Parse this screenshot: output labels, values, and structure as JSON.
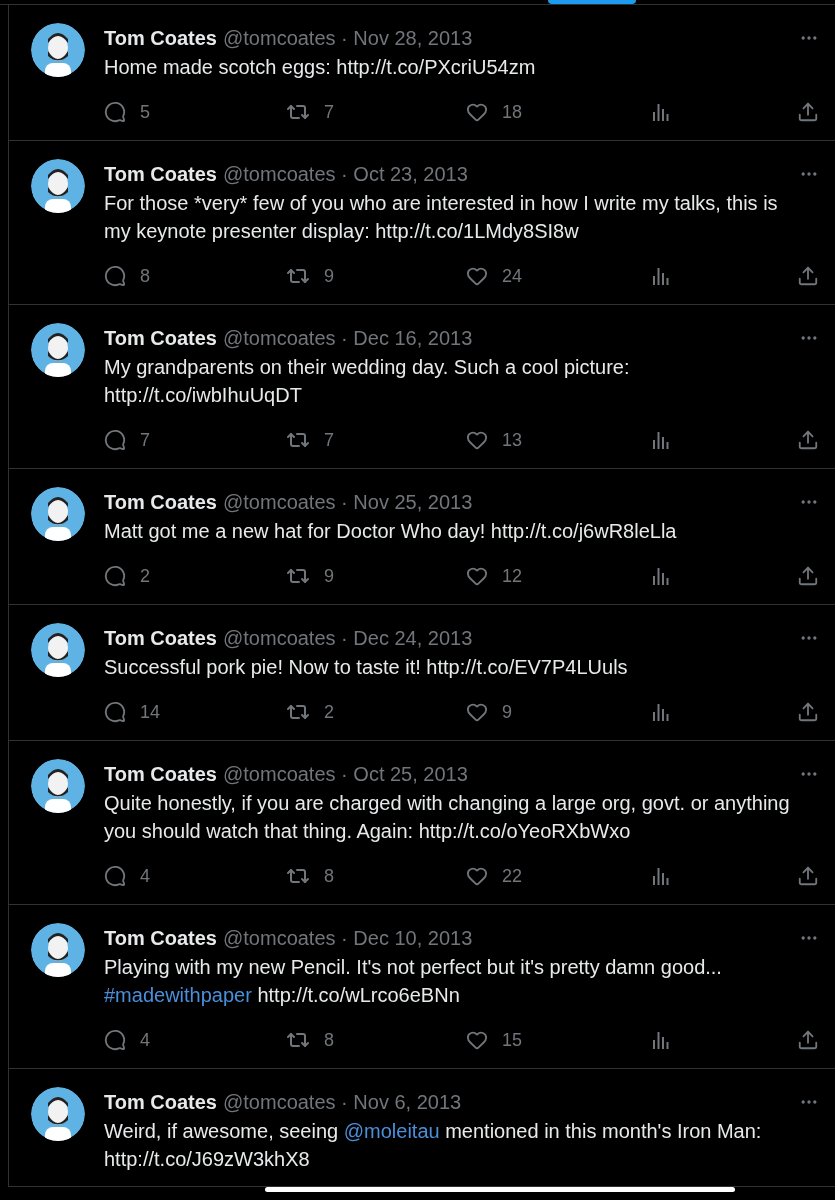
{
  "tweets": [
    {
      "name": "Tom Coates",
      "meta": "@tomcoates · Nov 28, 2013",
      "text": [
        {
          "kind": "text",
          "text": "Home made scotch eggs: http://t.co/PXcriU54zm"
        }
      ],
      "stats": {
        "replies": "5",
        "reposts": "7",
        "likes": "18"
      }
    },
    {
      "name": "Tom Coates",
      "meta": "@tomcoates · Oct 23, 2013",
      "text": [
        {
          "kind": "text",
          "text": "For those *very* few of you who are interested in how I write my talks, this is my keynote presenter display: http://t.co/1LMdy8SI8w"
        }
      ],
      "stats": {
        "replies": "8",
        "reposts": "9",
        "likes": "24"
      }
    },
    {
      "name": "Tom Coates",
      "meta": "@tomcoates · Dec 16, 2013",
      "text": [
        {
          "kind": "text",
          "text": "My grandparents on their wedding day. Such a cool picture: http://t.co/iwbIhuUqDT"
        }
      ],
      "stats": {
        "replies": "7",
        "reposts": "7",
        "likes": "13"
      }
    },
    {
      "name": "Tom Coates",
      "meta": "@tomcoates · Nov 25, 2013",
      "text": [
        {
          "kind": "text",
          "text": "Matt got me a new hat for Doctor Who day! http://t.co/j6wR8leLla"
        }
      ],
      "stats": {
        "replies": "2",
        "reposts": "9",
        "likes": "12"
      }
    },
    {
      "name": "Tom Coates",
      "meta": "@tomcoates · Dec 24, 2013",
      "text": [
        {
          "kind": "text",
          "text": "Successful pork pie! Now to taste it! http://t.co/EV7P4LUuls"
        }
      ],
      "stats": {
        "replies": "14",
        "reposts": "2",
        "likes": "9"
      }
    },
    {
      "name": "Tom Coates",
      "meta": "@tomcoates · Oct 25, 2013",
      "text": [
        {
          "kind": "text",
          "text": "Quite honestly, if you are charged with changing a large org, govt. or anything you should watch that thing. Again: http://t.co/oYeoRXbWxo"
        }
      ],
      "stats": {
        "replies": "4",
        "reposts": "8",
        "likes": "22"
      }
    },
    {
      "name": "Tom Coates",
      "meta": "@tomcoates · Dec 10, 2013",
      "text": [
        {
          "kind": "text",
          "text": "Playing with my new Pencil. It's not perfect but it's pretty damn good... "
        },
        {
          "kind": "hashtag",
          "text": "#madewithpaper"
        },
        {
          "kind": "text",
          "text": " http://t.co/wLrco6eBNn"
        }
      ],
      "stats": {
        "replies": "4",
        "reposts": "8",
        "likes": "15"
      }
    },
    {
      "name": "Tom Coates",
      "meta": "@tomcoates · Nov 6, 2013",
      "text": [
        {
          "kind": "text",
          "text": "Weird, if awesome, seeing "
        },
        {
          "kind": "mention",
          "text": "@moleitau"
        },
        {
          "kind": "text",
          "text": " mentioned in this month's Iron Man: http://t.co/J69zW3khX8"
        }
      ]
    }
  ]
}
